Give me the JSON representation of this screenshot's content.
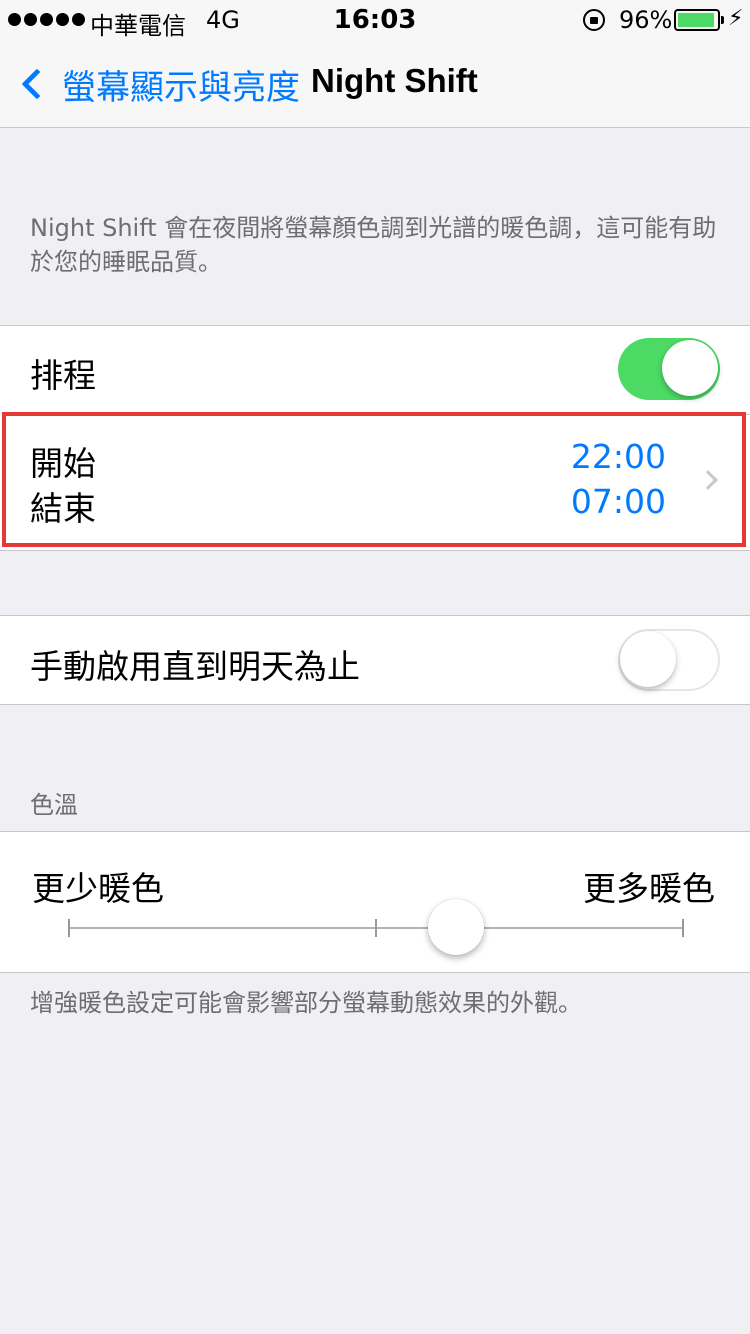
{
  "status_bar": {
    "carrier": "中華電信",
    "network": "4G",
    "time": "16:03",
    "battery_percent": "96%",
    "battery_color": "#4cd964",
    "icons": [
      "signal-dots-icon",
      "rotation-lock-icon",
      "battery-icon",
      "charging-bolt-icon"
    ]
  },
  "nav": {
    "back_label": "螢幕顯示與亮度",
    "title": "Night Shift",
    "accent_color": "#007aff"
  },
  "description": "Night Shift 會在夜間將螢幕顏色調到光譜的暖色調，這可能有助於您的睡眠品質。",
  "schedule": {
    "label": "排程",
    "enabled": true,
    "from_label": "開始",
    "from_time": "22:00",
    "to_label": "結束",
    "to_time": "07:00"
  },
  "manual": {
    "label": "手動啟用直到明天為止",
    "enabled": false
  },
  "color_temperature": {
    "header": "色溫",
    "less_warm_label": "更少暖色",
    "more_warm_label": "更多暖色",
    "value_fraction": 0.63,
    "footer": "增強暖色設定可能會影響部分螢幕動態效果的外觀。"
  },
  "toggle_on_color": "#4cd964"
}
